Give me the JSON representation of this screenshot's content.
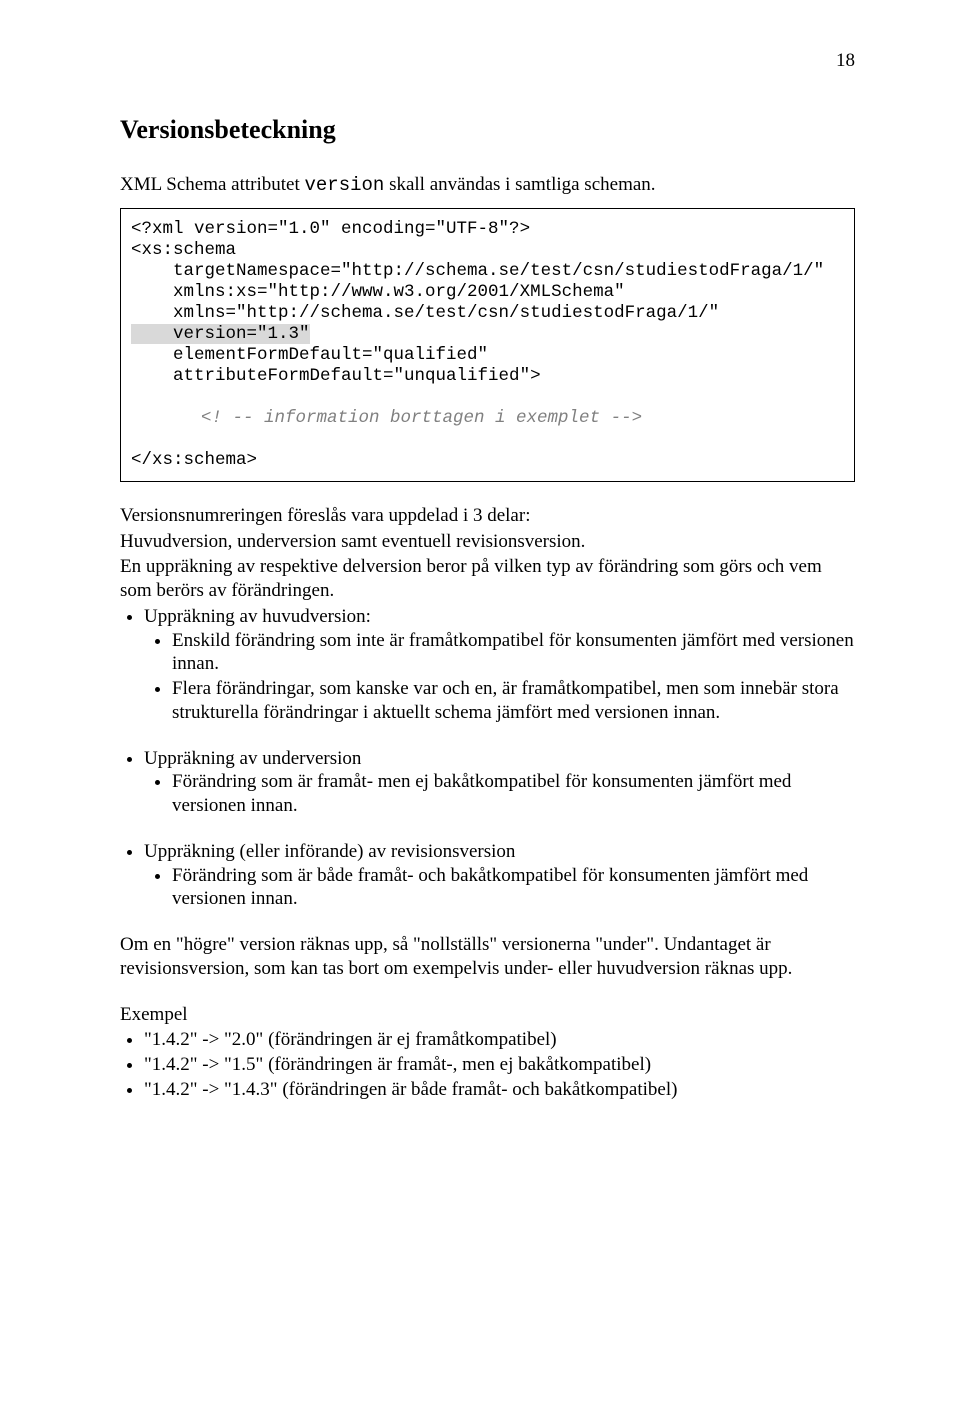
{
  "pageNumber": "18",
  "heading": "Versionsbeteckning",
  "introLine1Pre": "XML Schema attributet ",
  "introLine1Code": "version",
  "introLine1Post": " skall användas i samtliga scheman.",
  "code": {
    "l1": "<?xml version=\"1.0\" encoding=\"UTF-8\"?>",
    "l2": "<xs:schema",
    "l3": "    targetNamespace=\"http://schema.se/test/csn/studiestodFraga/1/\"",
    "l4": "    xmlns:xs=\"http://www.w3.org/2001/XMLSchema\"",
    "l5": "    xmlns=\"http://schema.se/test/csn/studiestodFraga/1/\"",
    "l6a": "    ",
    "l6b": "version=\"1.3\"",
    "l7": "    elementFormDefault=\"qualified\"",
    "l8": "    attributeFormDefault=\"unqualified\">",
    "l9": "<! -- information borttagen i exemplet -->",
    "l10": "</xs:schema>"
  },
  "p1a": "Versionsnumreringen föreslås vara uppdelad i 3 delar:",
  "p1b": "Huvudversion, underversion samt eventuell revisionsversion.",
  "p1c": "En uppräkning av respektive delversion beror på vilken typ av förändring som görs och vem som berörs av förändringen.",
  "list1": {
    "li1": "Uppräkning av huvudversion:",
    "li1a": "Enskild förändring som inte är framåtkompatibel för konsumenten jämfört med versionen innan.",
    "li1b": "Flera förändringar, som kanske var och en, är framåtkompatibel, men som innebär stora strukturella förändringar i aktuellt schema jämfört med versionen innan."
  },
  "list2": {
    "li1": "Uppräkning av underversion",
    "li1a": "Förändring som är framåt- men ej bakåtkompatibel för konsumenten jämfört med versionen innan."
  },
  "list3": {
    "li1": "Uppräkning (eller införande) av revisionsversion",
    "li1a": "Förändring som är både framåt- och bakåtkompatibel för konsumenten jämfört med versionen innan."
  },
  "p2a": "Om en \"högre\" version räknas upp, så \"nollställs\" versionerna \"under\". Undantaget är revisionsversion, som kan tas bort om exempelvis under- eller huvudversion räknas upp.",
  "exHeading": "Exempel",
  "ex1": "\"1.4.2\" -> \"2.0\" (förändringen  är ej framåtkompatibel)",
  "ex2": "\"1.4.2\" -> \"1.5\" (förändringen  är framåt-, men ej bakåtkompatibel)",
  "ex3": "\"1.4.2\" -> \"1.4.3\" (förändringen är både framåt- och bakåtkompatibel)"
}
